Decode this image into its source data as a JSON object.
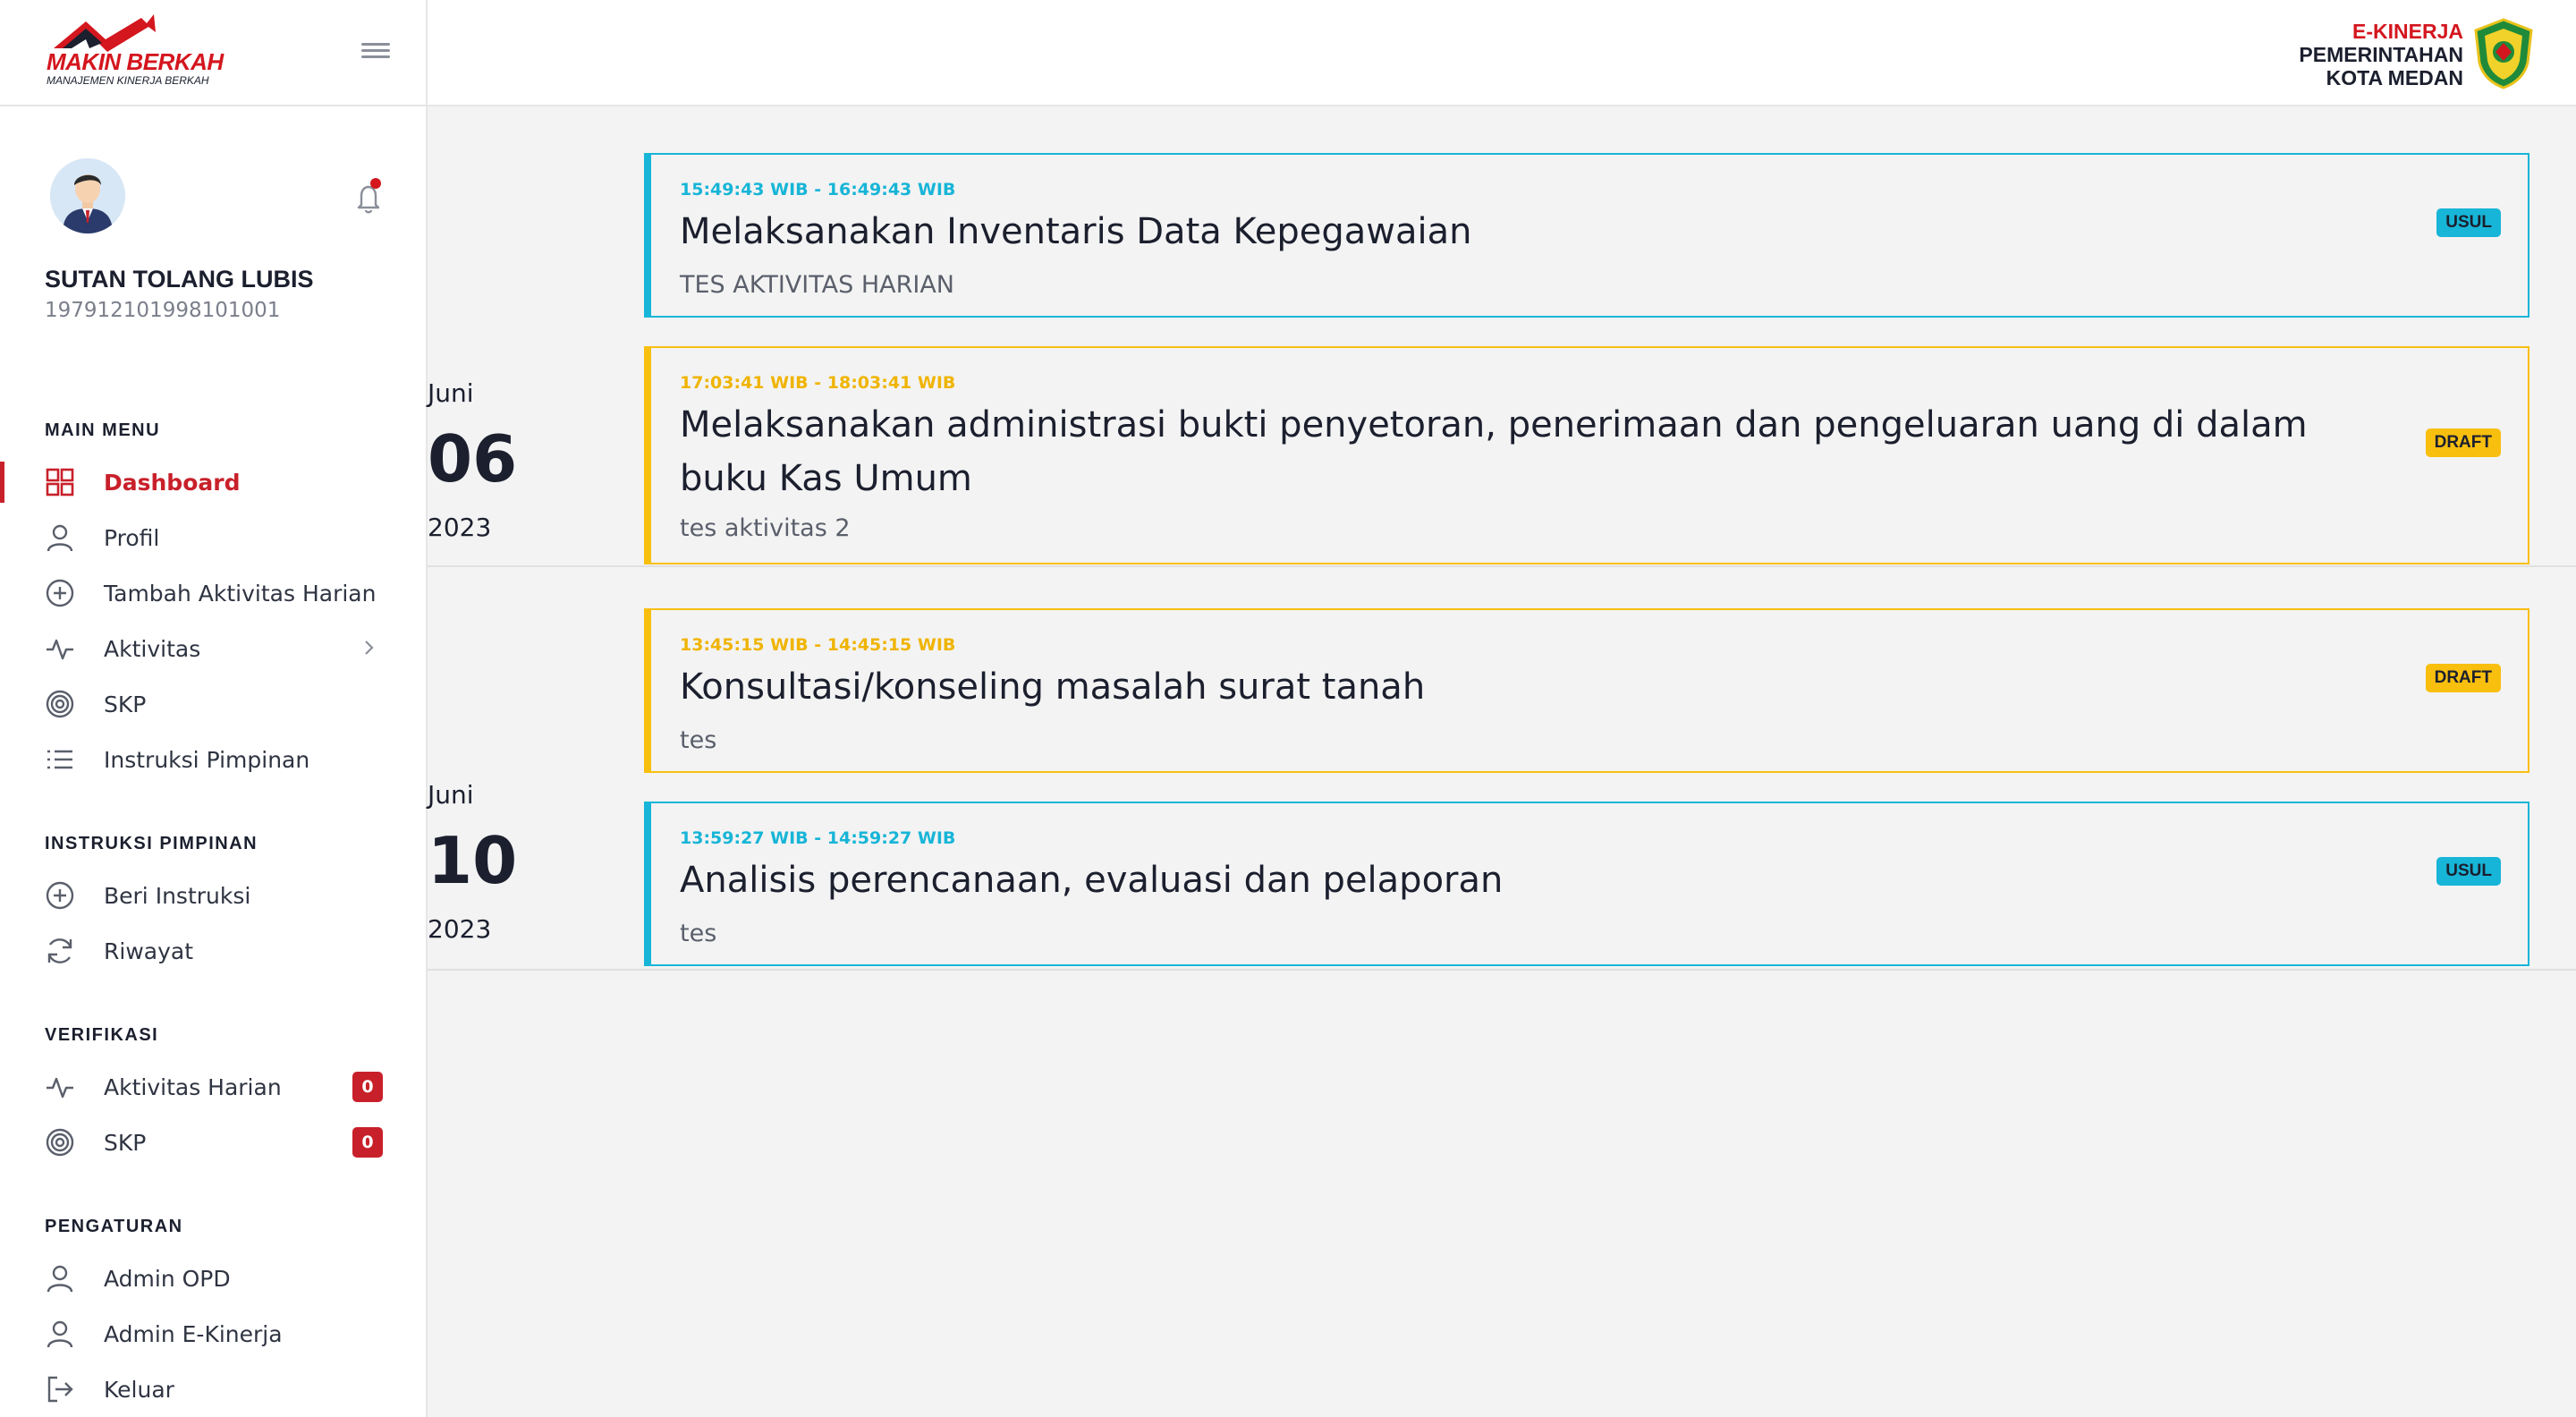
{
  "brand": {
    "name": "MAKIN BERKAH",
    "tagline": "MANAJEMEN KINERJA BERKAH"
  },
  "header": {
    "app_name": "E-KINERJA",
    "org_line1": "PEMERINTAHAN",
    "org_line2": "KOTA MEDAN"
  },
  "user": {
    "name": "SUTAN TOLANG LUBIS",
    "nip": "197912101998101001"
  },
  "menu": {
    "main_title": "MAIN MENU",
    "main_items": [
      {
        "label": "Dashboard",
        "icon": "grid-icon"
      },
      {
        "label": "Profil",
        "icon": "user-icon"
      },
      {
        "label": "Tambah Aktivitas Harian",
        "icon": "plus-circle-icon"
      },
      {
        "label": "Aktivitas",
        "icon": "activity-icon"
      },
      {
        "label": "SKP",
        "icon": "target-icon"
      },
      {
        "label": "Instruksi Pimpinan",
        "icon": "list-icon"
      }
    ],
    "instruksi_title": "INSTRUKSI PIMPINAN",
    "instruksi_items": [
      {
        "label": "Beri Instruksi",
        "icon": "plus-circle-icon"
      },
      {
        "label": "Riwayat",
        "icon": "refresh-icon"
      }
    ],
    "verifikasi_title": "VERIFIKASI",
    "verifikasi_items": [
      {
        "label": "Aktivitas Harian",
        "icon": "activity-icon",
        "count": "0"
      },
      {
        "label": "SKP",
        "icon": "target-icon",
        "count": "0"
      }
    ],
    "pengaturan_title": "PENGATURAN",
    "pengaturan_items": [
      {
        "label": "Admin OPD",
        "icon": "user-icon"
      },
      {
        "label": "Admin E-Kinerja",
        "icon": "user-icon"
      },
      {
        "label": "Keluar",
        "icon": "logout-icon"
      }
    ]
  },
  "colors": {
    "brand_red": "#c8202a",
    "usul": "#17b5d7",
    "draft": "#f9bf0f"
  },
  "days": [
    {
      "month": "Juni",
      "day": "06",
      "year": "2023",
      "activities": [
        {
          "time": "15:49:43 WIB - 16:49:43 WIB",
          "title": "Melaksanakan Inventaris Data Kepegawaian",
          "desc": "TES AKTIVITAS HARIAN",
          "status": "USUL"
        },
        {
          "time": "17:03:41 WIB - 18:03:41 WIB",
          "title": "Melaksanakan administrasi bukti penyetoran, penerimaan dan pengeluaran uang di dalam buku Kas Umum",
          "desc": "tes aktivitas 2",
          "status": "DRAFT"
        }
      ]
    },
    {
      "month": "Juni",
      "day": "10",
      "year": "2023",
      "activities": [
        {
          "time": "13:45:15 WIB - 14:45:15 WIB",
          "title": "Konsultasi/konseling masalah surat tanah",
          "desc": "tes",
          "status": "DRAFT"
        },
        {
          "time": "13:59:27 WIB - 14:59:27 WIB",
          "title": "Analisis perencanaan, evaluasi dan pelaporan",
          "desc": "tes",
          "status": "USUL"
        }
      ]
    }
  ]
}
